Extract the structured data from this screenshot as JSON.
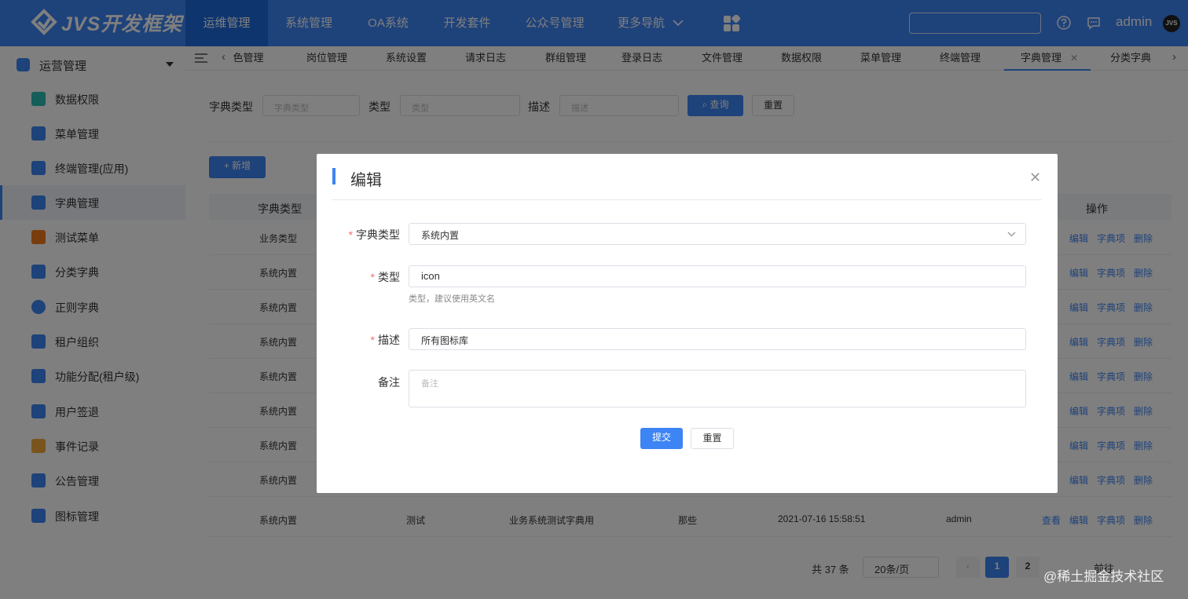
{
  "app": {
    "logo_text": "JVS开发框架",
    "nav": [
      "运维管理",
      "系统管理",
      "OA系统",
      "开发套件",
      "公众号管理",
      "更多导航"
    ],
    "username": "admin",
    "avatar_text": "JVS",
    "accent": "#3d84f5"
  },
  "sidebar": {
    "group": "运营管理",
    "items": [
      {
        "label": "数据权限",
        "icon": "data-permission-icon",
        "color": "#2bbcb2"
      },
      {
        "label": "菜单管理",
        "icon": "menu-manage-icon",
        "color": "#3d84f5"
      },
      {
        "label": "终端管理(应用)",
        "icon": "terminal-icon",
        "color": "#3d84f5"
      },
      {
        "label": "字典管理",
        "icon": "dictionary-icon",
        "color": "#3d84f5"
      },
      {
        "label": "测试菜单",
        "icon": "home-icon",
        "color": "#f27a1a"
      },
      {
        "label": "分类字典",
        "icon": "bar-chart-icon",
        "color": "#3d84f5"
      },
      {
        "label": "正则字典",
        "icon": "regex-icon",
        "color": "#3d84f5"
      },
      {
        "label": "租户组织",
        "icon": "org-icon",
        "color": "#3d84f5"
      },
      {
        "label": "功能分配(租户级)",
        "icon": "dropbox-icon",
        "color": "#3d84f5"
      },
      {
        "label": "用户签退",
        "icon": "signout-icon",
        "color": "#3d84f5"
      },
      {
        "label": "事件记录",
        "icon": "event-icon",
        "color": "#f2a93b"
      },
      {
        "label": "公告管理",
        "icon": "notice-icon",
        "color": "#3d84f5"
      },
      {
        "label": "图标管理",
        "icon": "icon-manage-icon",
        "color": "#3d84f5"
      }
    ]
  },
  "tabs": [
    "色管理",
    "岗位管理",
    "系统设置",
    "请求日志",
    "群组管理",
    "登录日志",
    "文件管理",
    "数据权限",
    "菜单管理",
    "终端管理",
    "字典管理",
    "分类字典"
  ],
  "filters": {
    "type_label": "字典类型",
    "type_placeholder": "字典类型",
    "kind_label": "类型",
    "kind_placeholder": "类型",
    "desc_label": "描述",
    "desc_placeholder": "描述",
    "query": "查询",
    "reset": "重置",
    "add": "+ 新增"
  },
  "table": {
    "head_type": "字典类型",
    "head_ops": "操作",
    "rows": [
      {
        "type": "业务类型"
      },
      {
        "type": "系统内置"
      },
      {
        "type": "系统内置"
      },
      {
        "type": "系统内置"
      },
      {
        "type": "系统内置"
      },
      {
        "type": "系统内置"
      },
      {
        "type": "系统内置"
      },
      {
        "type": "系统内置"
      }
    ],
    "last_row": {
      "type": "系统内置",
      "kind": "测试",
      "desc": "业务系统测试字典用",
      "remark": "那些",
      "time": "2021-07-16 15:58:51",
      "user": "admin"
    },
    "actions": {
      "view": "查看",
      "edit": "编辑",
      "item": "字典项",
      "del": "删除"
    }
  },
  "pagination": {
    "total": "共 37 条",
    "size": "20条/页",
    "page1": "1",
    "page2": "2",
    "goto": "前往"
  },
  "modal": {
    "title": "编辑",
    "type_label": "字典类型",
    "type_value": "系统内置",
    "kind_label": "类型",
    "kind_value": "icon",
    "kind_hint": "类型，建议使用英文名",
    "desc_label": "描述",
    "desc_value": "所有图标库",
    "remark_label": "备注",
    "remark_placeholder": "备注",
    "submit": "提交",
    "reset": "重置",
    "required_mark": "*"
  },
  "watermark": "@稀土掘金技术社区"
}
